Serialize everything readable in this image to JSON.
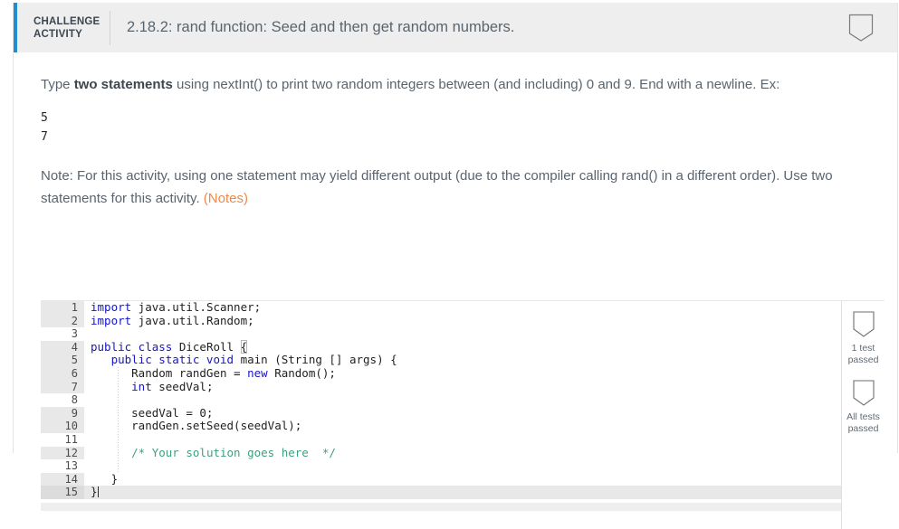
{
  "header": {
    "kicker_line1": "CHALLENGE",
    "kicker_line2": "ACTIVITY",
    "title": "2.18.2: rand function: Seed and then get random numbers.",
    "badge_icon": "shield-icon",
    "accent_color": "#1f8dd0"
  },
  "prompt": {
    "before_bold": "Type ",
    "bold": "two statements",
    "after_bold": " using nextInt() to print two random integers between (and including) 0 and 9. End with a newline. Ex:"
  },
  "example_output": "5\n7",
  "note": {
    "text": "Note: For this activity, using one statement may yield different output (due to the compiler calling rand() in a different order). Use two statements for this activity. ",
    "link_label": "(Notes)",
    "link_color": "#f08a4b"
  },
  "editor": {
    "language": "java",
    "active_line": 15,
    "lines": [
      {
        "n": "1",
        "tokens": [
          {
            "t": "import",
            "c": "kw"
          },
          {
            "t": " java.util.Scanner;",
            "c": "plain"
          }
        ]
      },
      {
        "n": "2",
        "tokens": [
          {
            "t": "import",
            "c": "kw"
          },
          {
            "t": " java.util.Random;",
            "c": "plain"
          }
        ]
      },
      {
        "n": "3",
        "tokens": []
      },
      {
        "n": "4",
        "tokens": [
          {
            "t": "public class",
            "c": "kw"
          },
          {
            "t": " DiceRoll ",
            "c": "plain"
          },
          {
            "t": "{",
            "c": "brace"
          }
        ]
      },
      {
        "n": "5",
        "tokens": [
          {
            "t": "   ",
            "c": "plain"
          },
          {
            "t": "public static void",
            "c": "kw"
          },
          {
            "t": " main (String [] args) {",
            "c": "plain"
          }
        ]
      },
      {
        "n": "6",
        "tokens": [
          {
            "t": "      Random randGen = ",
            "c": "plain"
          },
          {
            "t": "new",
            "c": "kw"
          },
          {
            "t": " Random();",
            "c": "plain"
          }
        ]
      },
      {
        "n": "7",
        "tokens": [
          {
            "t": "      ",
            "c": "plain"
          },
          {
            "t": "int",
            "c": "kw"
          },
          {
            "t": " seedVal;",
            "c": "plain"
          }
        ]
      },
      {
        "n": "8",
        "tokens": []
      },
      {
        "n": "9",
        "tokens": [
          {
            "t": "      seedVal = 0;",
            "c": "plain"
          }
        ]
      },
      {
        "n": "10",
        "tokens": [
          {
            "t": "      randGen.setSeed(seedVal);",
            "c": "plain"
          }
        ]
      },
      {
        "n": "11",
        "tokens": []
      },
      {
        "n": "12",
        "tokens": [
          {
            "t": "      ",
            "c": "plain"
          },
          {
            "t": "/* Your solution goes here  */",
            "c": "cmt"
          }
        ]
      },
      {
        "n": "13",
        "tokens": []
      },
      {
        "n": "14",
        "tokens": [
          {
            "t": "   }",
            "c": "plain"
          }
        ]
      },
      {
        "n": "15",
        "tokens": [
          {
            "t": "}",
            "c": "plain"
          },
          {
            "t": "",
            "c": "cursor"
          }
        ]
      }
    ]
  },
  "tests": [
    {
      "icon": "shield-icon",
      "label_line1": "1 test",
      "label_line2": "passed"
    },
    {
      "icon": "shield-icon",
      "label_line1": "All tests",
      "label_line2": "passed"
    }
  ]
}
